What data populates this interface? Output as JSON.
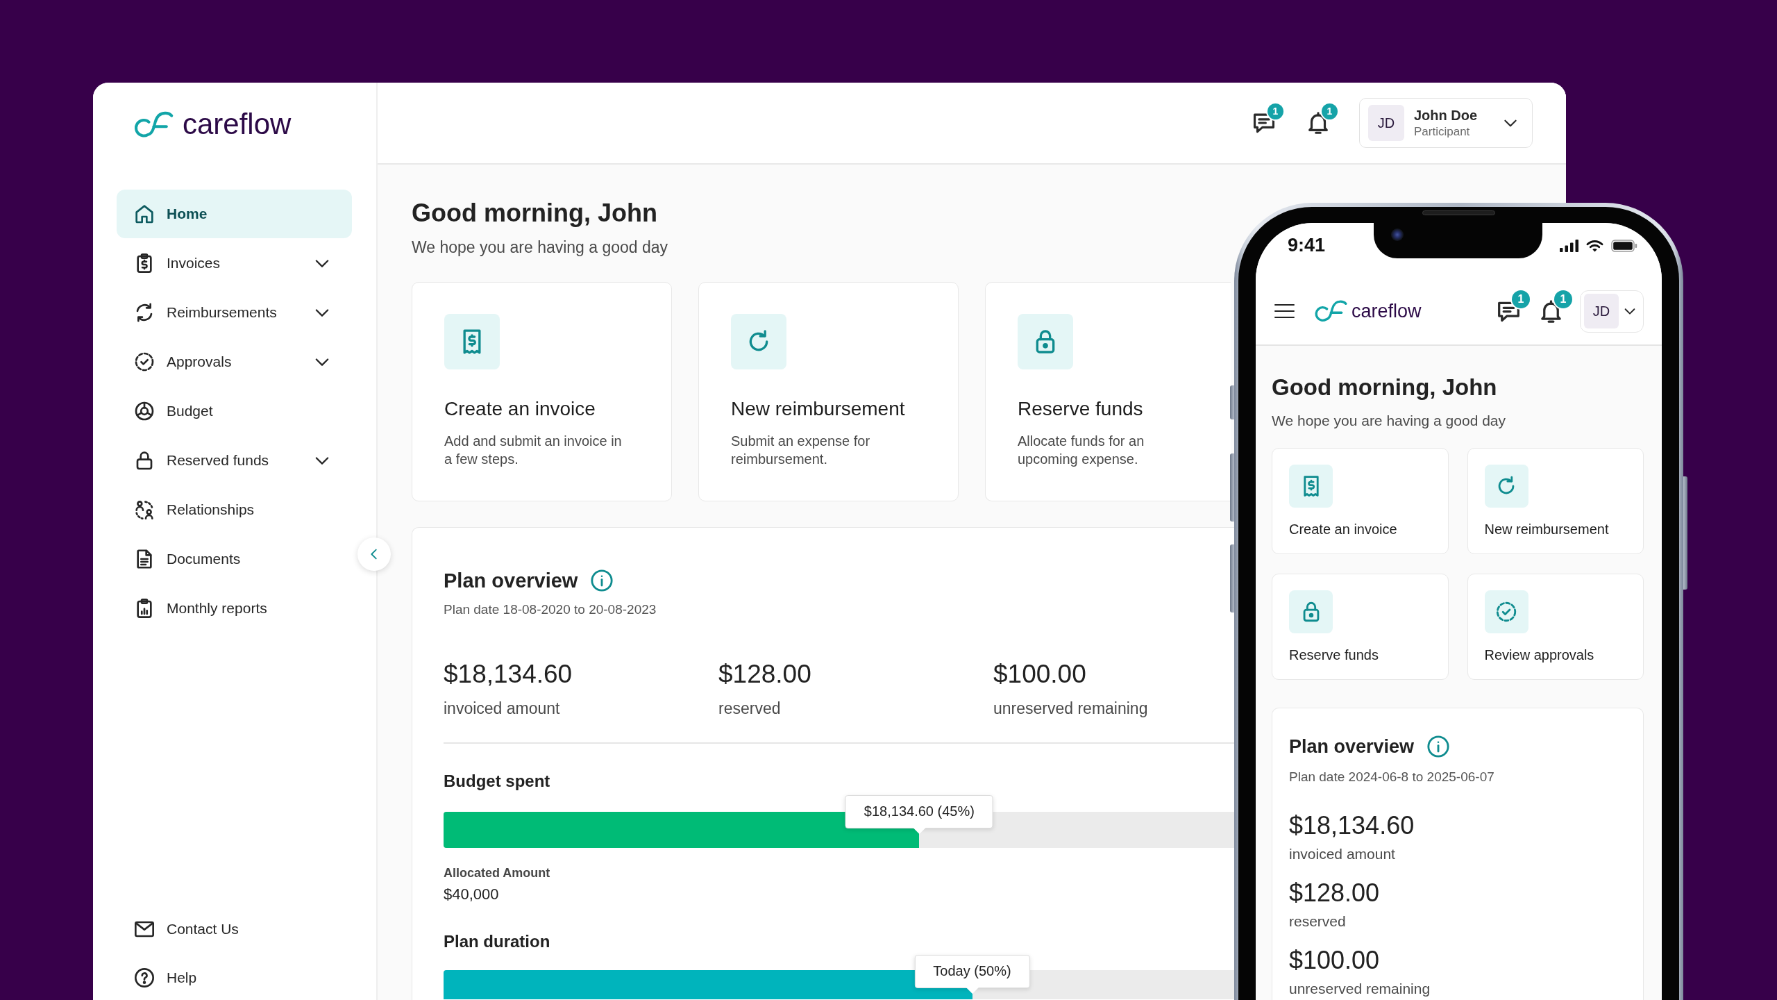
{
  "desktop": {
    "logo": {
      "text": "careflow"
    },
    "sidebar": {
      "items": [
        {
          "kind": "home",
          "label": "Home",
          "selected": true,
          "expandable": false
        },
        {
          "kind": "invoice",
          "label": "Invoices",
          "selected": false,
          "expandable": true
        },
        {
          "kind": "refresh",
          "label": "Reimbursements",
          "selected": false,
          "expandable": true
        },
        {
          "kind": "approval",
          "label": "Approvals",
          "selected": false,
          "expandable": true
        },
        {
          "kind": "budget",
          "label": "Budget",
          "selected": false,
          "expandable": false
        },
        {
          "kind": "lock",
          "label": "Reserved funds",
          "selected": false,
          "expandable": true
        },
        {
          "kind": "people",
          "label": "Relationships",
          "selected": false,
          "expandable": false
        },
        {
          "kind": "document",
          "label": "Documents",
          "selected": false,
          "expandable": false
        },
        {
          "kind": "report",
          "label": "Monthly reports",
          "selected": false,
          "expandable": false
        }
      ],
      "footer_items": [
        {
          "kind": "mail",
          "label": "Contact Us"
        },
        {
          "kind": "help",
          "label": "Help"
        }
      ]
    },
    "header": {
      "messages_count": "1",
      "notifications_count": "1",
      "user": {
        "initials": "JD",
        "name": "John Doe",
        "role": "Participant"
      }
    },
    "greeting": {
      "title": "Good morning, John",
      "subtitle": "We hope you are having a good day"
    },
    "actions": [
      {
        "kind": "invoice",
        "title": "Create an invoice",
        "description": "Add and submit an invoice in a few steps."
      },
      {
        "kind": "refresh",
        "title": "New reimbursement",
        "description": "Submit an expense for reimbursement."
      },
      {
        "kind": "lock",
        "title": "Reserve funds",
        "description": "Allocate funds for an upcoming expense."
      }
    ],
    "plan_overview": {
      "title": "Plan overview",
      "date_range": "Plan date 18-08-2020 to 20-08-2023",
      "stats": [
        {
          "value": "$18,134.60",
          "label": "invoiced amount"
        },
        {
          "value": "$128.00",
          "label": "reserved"
        },
        {
          "value": "$100.00",
          "label": "unreserved remaining"
        }
      ],
      "budget": {
        "title": "Budget spent",
        "level": 0.45,
        "tooltip": "$18,134.60 (45%)",
        "allocated_label": "Allocated Amount",
        "allocated_value": "$40,000"
      },
      "duration": {
        "title": "Plan duration",
        "level": 0.5,
        "tooltip": "Today (50%)"
      }
    }
  },
  "phone": {
    "status_bar": {
      "time": "9:41"
    },
    "logo": {
      "text": "careflow"
    },
    "header": {
      "messages_count": "1",
      "notifications_count": "1",
      "user": {
        "initials": "JD"
      }
    },
    "greeting": {
      "title": "Good morning, John",
      "subtitle": "We hope you are having a good day"
    },
    "actions": [
      {
        "kind": "invoice",
        "title": "Create an invoice"
      },
      {
        "kind": "refresh",
        "title": "New reimbursement"
      },
      {
        "kind": "lock",
        "title": "Reserve funds"
      },
      {
        "kind": "approval",
        "title": "Review approvals"
      }
    ],
    "plan_overview": {
      "title": "Plan overview",
      "date_range": "Plan date 2024-06-8 to 2025-06-07",
      "stats": [
        {
          "value": "$18,134.60",
          "label": "invoiced amount"
        },
        {
          "value": "$128.00",
          "label": "reserved"
        },
        {
          "value": "$100.00",
          "label": "unreserved remaining"
        }
      ]
    }
  }
}
